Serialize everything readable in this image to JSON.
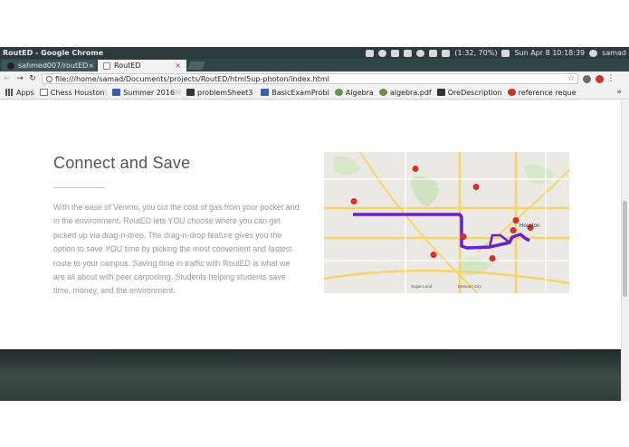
{
  "system_bar": {
    "window_title": "RoutED - Google Chrome",
    "battery": "(1:32, 70%)",
    "clock": "Sun Apr  8 10:18:39",
    "user": "samad"
  },
  "tabs": [
    {
      "label": "sahmed007/routED",
      "active": false
    },
    {
      "label": "RoutED",
      "active": true
    }
  ],
  "tab_close_glyph": "×",
  "address_bar": {
    "url": "file:///home/samad/Documents/projects/RoutED/html5up-photon/index.html"
  },
  "bookmarks": [
    {
      "label": "Apps",
      "icon": "apps-icon"
    },
    {
      "label": "Chess Houston ",
      "fade": "\\",
      "icon": "page-icon"
    },
    {
      "label": "Summer 2016 ",
      "fade": "M",
      "icon": "doc-blue-icon"
    },
    {
      "label": "problemSheet3",
      "fade": "-",
      "icon": "doc-dark-icon"
    },
    {
      "label": "BasicExamProbl",
      "fade": "",
      "icon": "doc-blue-icon"
    },
    {
      "label": "Algebra",
      "fade": "",
      "icon": "leaf-icon"
    },
    {
      "label": "algebra.pdf",
      "fade": "",
      "icon": "leaf-icon"
    },
    {
      "label": "OreDescription",
      "fade": "",
      "icon": "link-icon"
    },
    {
      "label": "reference reque",
      "fade": "",
      "icon": "gear-red-icon"
    }
  ],
  "bookmarks_overflow": "»",
  "content": {
    "heading": "Connect and Save",
    "paragraph": "With the ease of Venmo, you cut the cost of gas from your pocket and in the environment. RoutED lets YOU choose where you can get picked up via drag-n-drop. The drag-n-drop feature gives you the option to save YOU time by picking the most convenient and fastest route to your campus. Saving time in traffic with RoutED is what we are all about with peer carpooling. Students helping students save time, money, and the environment."
  },
  "map": {
    "labels": [
      "Houston",
      "Missouri City",
      "Sugar Land"
    ],
    "route_color": "#6a1fd1",
    "pin_color": "#d93025"
  },
  "colors": {
    "system_bar": "#2b3a3d",
    "tab_strip": "#2f4548",
    "heading_text": "#555555",
    "body_text": "#9a9a9a"
  }
}
